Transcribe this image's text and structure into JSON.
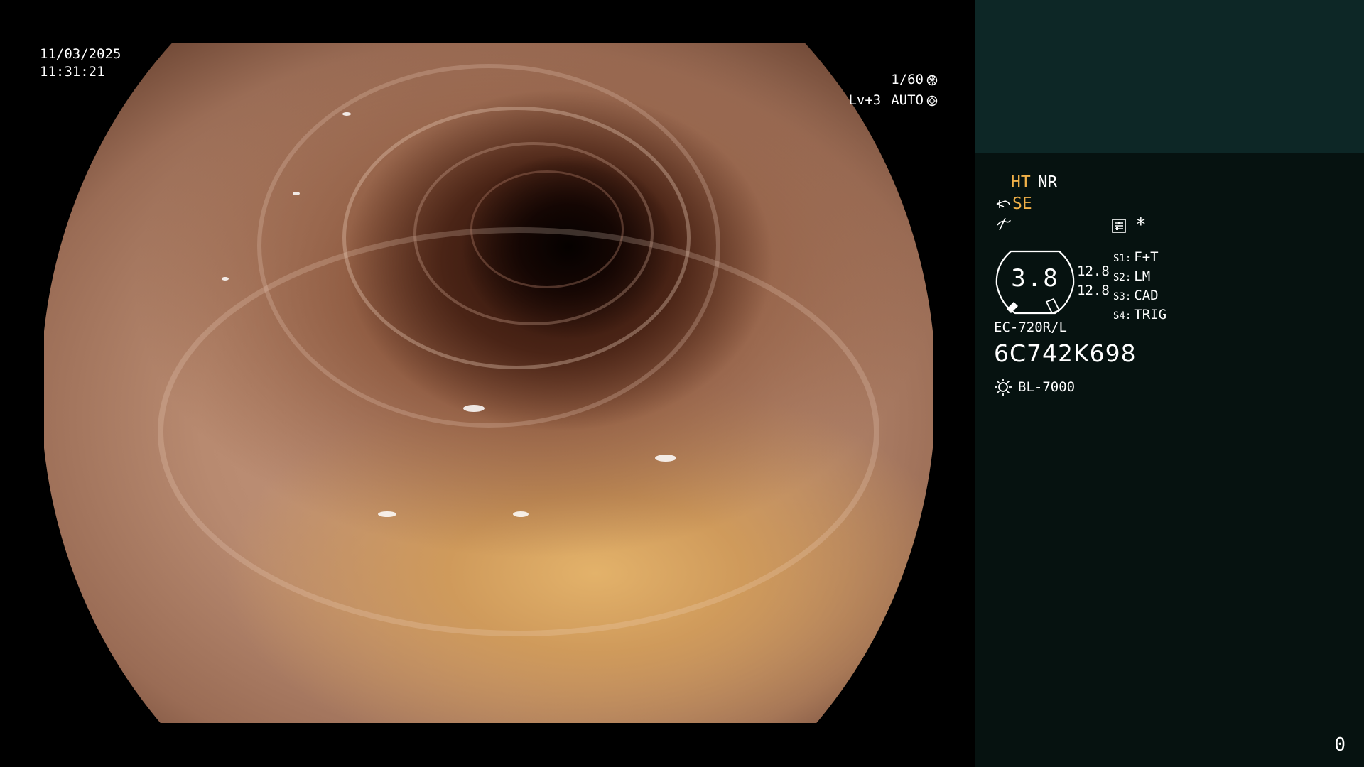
{
  "overlay": {
    "date": "11/03/2025",
    "time": "11:31:21",
    "shutter": "1/60",
    "level": "Lv+3",
    "mode": "AUTO"
  },
  "panel": {
    "ht": "HT",
    "nr": "NR",
    "se": "SE",
    "gauge_value": "3.8",
    "gauge_num_1": "12.8",
    "gauge_num_2": "12.8",
    "asterisk": "*",
    "switches": [
      {
        "key": "S1:",
        "value": "F+T"
      },
      {
        "key": "S2:",
        "value": "LM"
      },
      {
        "key": "S3:",
        "value": "CAD"
      },
      {
        "key": "S4:",
        "value": "TRIG"
      }
    ],
    "scope_model": "EC-720R/L",
    "scope_serial": "6C742K698",
    "light_source": "BL-7000",
    "counter": "0"
  },
  "icons": {
    "shutter_icon": "aperture-icon",
    "auto_icon": "iris-icon",
    "se_icon": "scope-tip-icon",
    "mode3_icon": "slash-curve-icon",
    "settings_icon": "menu-box-icon",
    "light_icon": "sun-icon"
  },
  "colors": {
    "accent_orange": "#f0b048",
    "panel_top": "#0d2726",
    "panel_bottom": "#061210"
  }
}
